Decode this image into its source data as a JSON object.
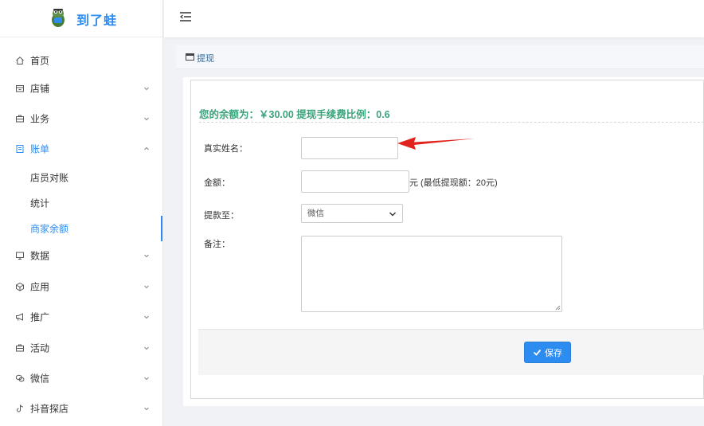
{
  "brand": {
    "name": "到了蛙"
  },
  "sidebar": {
    "items": [
      {
        "label": "首页",
        "icon": "home-icon",
        "has_children": false
      },
      {
        "label": "店铺",
        "icon": "store-icon",
        "has_children": true
      },
      {
        "label": "业务",
        "icon": "briefcase-icon",
        "has_children": true
      },
      {
        "label": "账单",
        "icon": "bill-icon",
        "has_children": true,
        "expanded": true,
        "active": true
      },
      {
        "label": "数据",
        "icon": "monitor-icon",
        "has_children": true
      },
      {
        "label": "应用",
        "icon": "cube-icon",
        "has_children": true
      },
      {
        "label": "推广",
        "icon": "megaphone-icon",
        "has_children": true
      },
      {
        "label": "活动",
        "icon": "activity-icon",
        "has_children": true
      },
      {
        "label": "微信",
        "icon": "wechat-icon",
        "has_children": true
      },
      {
        "label": "抖音探店",
        "icon": "tiktok-icon",
        "has_children": true
      }
    ],
    "bill_sub_items": [
      {
        "label": "店员对账"
      },
      {
        "label": "统计"
      },
      {
        "label": "商家余额",
        "active": true
      }
    ]
  },
  "breadcrumb": {
    "label": "提现"
  },
  "form": {
    "balance_title": "您的余额为：￥30.00 提现手续费比例：0.6",
    "real_name_label": "真实姓名：",
    "real_name_value": "",
    "amount_label": "金额：",
    "amount_value": "",
    "amount_note": "元 (最低提现额：20元)",
    "withdraw_to_label": "提款至：",
    "withdraw_to_selected": "微信",
    "remark_label": "备注：",
    "remark_value": "",
    "save_label": "保存"
  },
  "colors": {
    "accent": "#2d8cf0",
    "balance_text": "#3aa37a",
    "annotation_arrow": "#e0231c"
  }
}
